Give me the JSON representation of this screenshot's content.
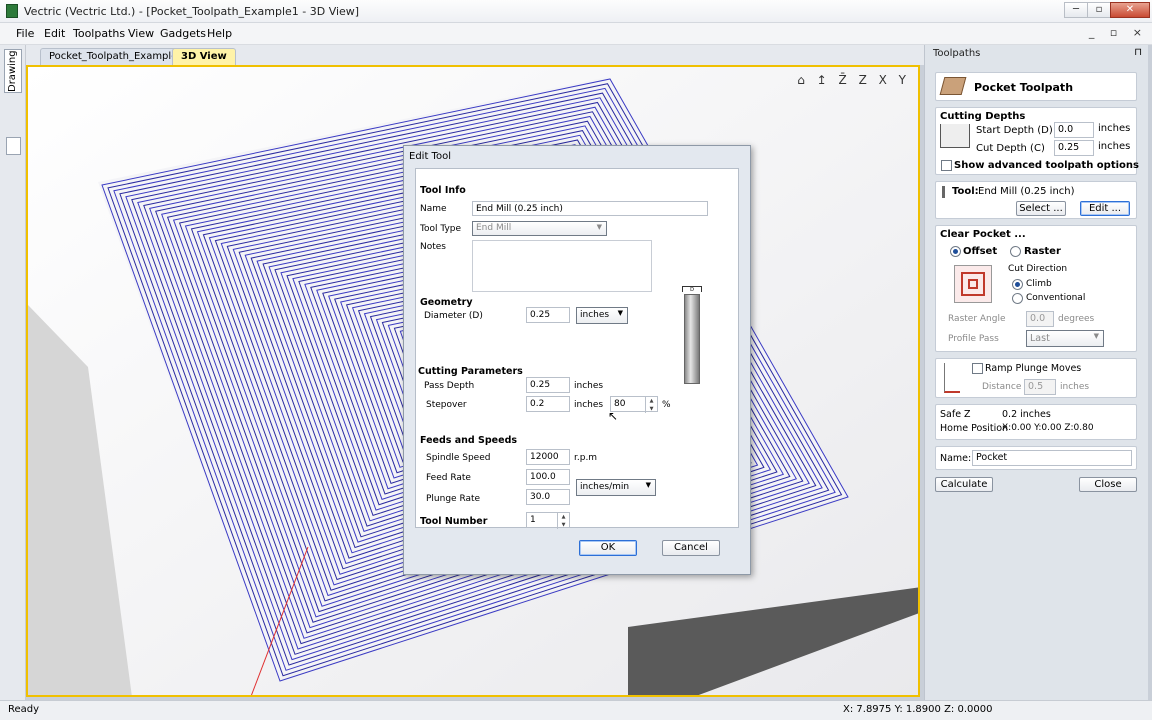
{
  "window": {
    "title": "Vectric (Vectric Ltd.) - [Pocket_Toolpath_Example1 - 3D View]",
    "min_icon": "minimize-icon",
    "max_icon": "maximize-icon",
    "close_icon": "close-icon"
  },
  "menu": [
    "File",
    "Edit",
    "Toolpaths",
    "View",
    "Gadgets",
    "Help"
  ],
  "mdi_controls": "_ ▫ ×",
  "left_tabs": {
    "drawing": "Drawing"
  },
  "doc_tabs": [
    {
      "label": "Pocket_Toolpath_Example1",
      "active": false
    },
    {
      "label": "3D View",
      "active": true
    }
  ],
  "view_icons": "⌂ ↥ Z̄ Z X Y",
  "toolpaths_panel": {
    "header": "Toolpaths",
    "pin": "⊓",
    "title": "Pocket Toolpath",
    "cutting_depths": {
      "heading": "Cutting Depths",
      "start_label": "Start Depth (D)",
      "start_value": "0.0",
      "cut_label": "Cut Depth (C)",
      "cut_value": "0.25",
      "units": "inches",
      "advanced": "Show advanced toolpath options"
    },
    "tool": {
      "label": "Tool:",
      "value": "End Mill (0.25 inch)",
      "select": "Select ...",
      "edit": "Edit ..."
    },
    "clear_pocket": {
      "heading": "Clear Pocket ...",
      "offset": "Offset",
      "raster": "Raster",
      "cut_direction": "Cut Direction",
      "climb": "Climb",
      "conventional": "Conventional",
      "raster_angle_label": "Raster Angle",
      "raster_angle": "0.0",
      "degrees": "degrees",
      "profile_pass_label": "Profile Pass",
      "profile_pass": "Last"
    },
    "ramp": {
      "label": "Ramp Plunge Moves",
      "distance_label": "Distance",
      "distance": "0.5",
      "units": "inches"
    },
    "safe_z": {
      "label": "Safe Z",
      "value": "0.2 inches",
      "home_label": "Home Position",
      "home_value": "X:0.00 Y:0.00 Z:0.80"
    },
    "name": {
      "label": "Name:",
      "value": "Pocket"
    },
    "calculate": "Calculate",
    "close": "Close"
  },
  "dialog": {
    "title": "Edit Tool",
    "tool_info": "Tool Info",
    "name_label": "Name",
    "name_value": "End Mill (0.25 inch)",
    "type_label": "Tool Type",
    "type_value": "End Mill",
    "notes_label": "Notes",
    "geometry": "Geometry",
    "diameter_label": "Diameter (D)",
    "diameter": "0.25",
    "units": "inches",
    "cutting_params": "Cutting Parameters",
    "pass_depth_label": "Pass Depth",
    "pass_depth": "0.25",
    "stepover_label": "Stepover",
    "stepover": "0.2",
    "stepover_pct": "80",
    "pct": "%",
    "feeds": "Feeds and Speeds",
    "spindle_label": "Spindle Speed",
    "spindle": "12000",
    "rpm": "r.p.m",
    "feed_label": "Feed Rate",
    "feed": "100.0",
    "plunge_label": "Plunge Rate",
    "plunge": "30.0",
    "rate_units": "inches/min",
    "tool_number_label": "Tool Number",
    "tool_number": "1",
    "ok": "OK",
    "cancel": "Cancel",
    "d_marker": "D"
  },
  "status": {
    "left": "Ready",
    "right": "X: 7.8975 Y: 1.8900 Z: 0.0000"
  }
}
